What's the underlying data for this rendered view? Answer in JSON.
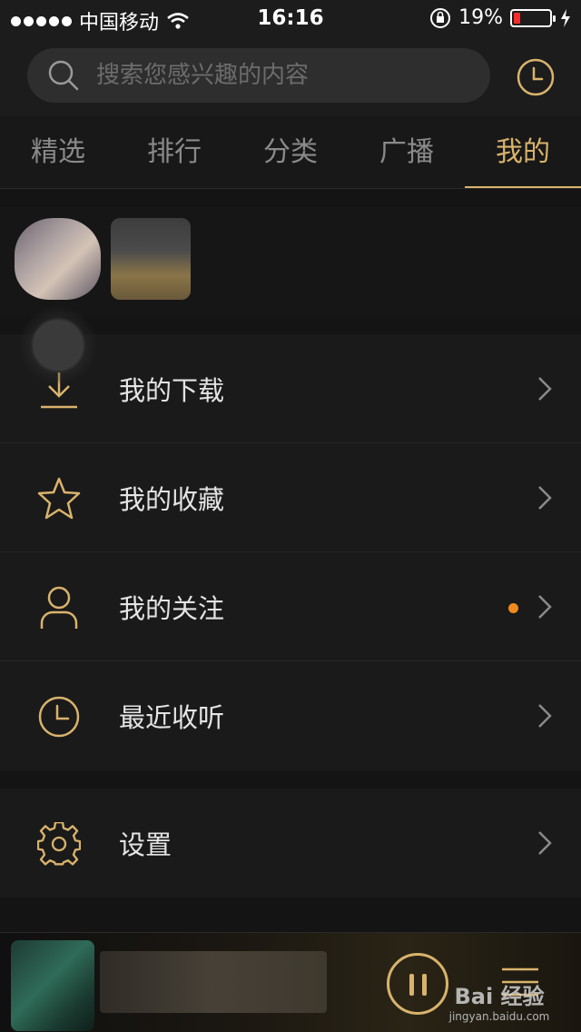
{
  "status_bar": {
    "carrier": "中国移动",
    "time": "16:16",
    "battery_percent": "19%",
    "battery_level": 0.19,
    "icons": [
      "signal-dots-icon",
      "wifi-icon",
      "rotation-lock-icon",
      "battery-icon",
      "charging-icon"
    ]
  },
  "search": {
    "placeholder": "搜索您感兴趣的内容",
    "icon": "search-icon"
  },
  "header": {
    "history_icon": "clock-icon"
  },
  "tabs": [
    {
      "label": "精选",
      "active": false
    },
    {
      "label": "排行",
      "active": false
    },
    {
      "label": "分类",
      "active": false
    },
    {
      "label": "广播",
      "active": false
    },
    {
      "label": "我的",
      "active": true
    }
  ],
  "menu": {
    "items": [
      {
        "label": "我的下载",
        "icon": "download-icon"
      },
      {
        "label": "我的收藏",
        "icon": "star-icon"
      },
      {
        "label": "我的关注",
        "icon": "person-icon",
        "badge_dot": true
      },
      {
        "label": "最近收听",
        "icon": "clock-icon"
      }
    ],
    "settings": {
      "label": "设置",
      "icon": "gear-icon"
    }
  },
  "player": {
    "play_state": "playing",
    "pause_icon": "pause-icon",
    "playlist_icon": "playlist-icon"
  },
  "watermark": {
    "brand": "Bai 经验",
    "url": "jingyan.baidu.com"
  },
  "colors": {
    "accent": "#d9b36c",
    "background": "#141414",
    "dot": "#f08a1c",
    "battery_low": "#ff2b2b"
  }
}
